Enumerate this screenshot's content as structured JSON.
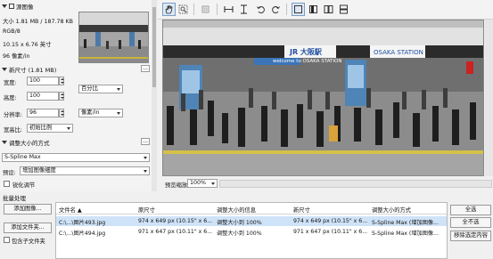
{
  "source_section": {
    "title": "源图像",
    "size": "大小 1.81 MB / 187.78 KB",
    "mode": "RGB/8",
    "dimensions_cm": "10.15 x 6.76 英寸",
    "resolution": "96 像素/in"
  },
  "new_size_section": {
    "title": "新尺寸 (1.81 MB)",
    "width_label": "宽度:",
    "width_value": "100",
    "height_label": "高度:",
    "height_value": "100",
    "unit_value": "百分比",
    "resolution_label": "分辨率:",
    "resolution_value": "96",
    "resolution_unit": "像素/in",
    "aspect_label": "宽高比:",
    "aspect_value": "初始比例"
  },
  "resample_section": {
    "title": "调整大小的方式",
    "method_value": "S-Spline Max",
    "preset_label": "预设:",
    "preset_value": "增加图像细度",
    "checkbox_label": "锐化调节"
  },
  "toolbar": {
    "icons": [
      "hand-icon",
      "zoom-select-icon",
      "crop-icon",
      "fit-width-icon",
      "fit-height-icon",
      "rotate-left-icon",
      "rotate-right-icon",
      "single-view-icon",
      "split-vertical-icon",
      "split-dual-icon",
      "split-horizontal-icon"
    ]
  },
  "preview": {
    "sign_welcome": "welcome to OSAKA STATION",
    "sign_station_jp": "JR 大阪駅",
    "sign_station_en": "OSAKA STATION",
    "zoom_label": "预览缩放:",
    "zoom_value": "100%"
  },
  "batch": {
    "title": "批量处理",
    "add_images_button": "添加图像...",
    "add_folder_button": "添加文件夹...",
    "include_subfolders_label": "包含子文件夹",
    "columns": [
      "文件名 ▲",
      "原尺寸",
      "调整大小的信息",
      "新尺寸",
      "调整大小的方式"
    ],
    "rows": [
      {
        "file": "C:\\...\\图片493.jpg",
        "orig": "974 x 649 px (10.15\" x 6...",
        "info": "调整大小到 100%",
        "new": "974 x 649 px (10.15\" x 6...",
        "method": "S-Spline Max (增加图像..."
      },
      {
        "file": "C:\\...\\图片494.jpg",
        "orig": "971 x 647 px (10.11\" x 6...",
        "info": "调整大小到 100%",
        "new": "971 x 647 px (10.11\" x 6...",
        "method": "S-Spline Max (增加图像..."
      }
    ],
    "select_all_button": "全选",
    "deselect_all_button": "全不选",
    "remove_from_list_button": "移除选定内容"
  },
  "colors": {
    "selection": "#cfe3f8",
    "accent": "#7a9cc8"
  }
}
